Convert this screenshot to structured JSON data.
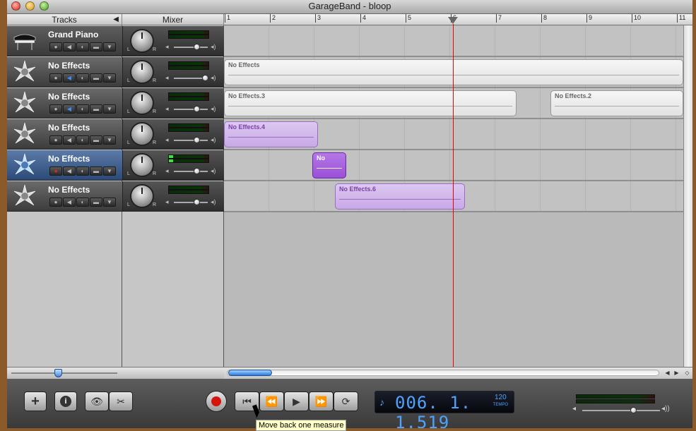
{
  "window": {
    "title": "GarageBand - bloop"
  },
  "headers": {
    "tracks": "Tracks",
    "mixer": "Mixer",
    "collapse_icon": "triangle-left-icon"
  },
  "ruler": {
    "marks": [
      "1",
      "2",
      "3",
      "4",
      "5",
      "6",
      "7",
      "8",
      "9",
      "10",
      "11"
    ]
  },
  "tracks": [
    {
      "name": "Grand Piano",
      "icon": "piano-icon",
      "selected": false
    },
    {
      "name": "No Effects",
      "icon": "star-guitar-icon",
      "selected": false
    },
    {
      "name": "No Effects",
      "icon": "star-guitar-icon",
      "selected": false
    },
    {
      "name": "No Effects",
      "icon": "star-guitar-icon",
      "selected": false
    },
    {
      "name": "No Effects",
      "icon": "star-guitar-icon",
      "selected": true
    },
    {
      "name": "No Effects",
      "icon": "star-guitar-icon",
      "selected": false
    }
  ],
  "mixer": {
    "pan_left": "L",
    "pan_right": "R"
  },
  "regions": {
    "r1": "No Effects",
    "r2a": "No Effects.3",
    "r2b": "No Effects.2",
    "r3": "No Effects.4",
    "r4": "No",
    "r5": "No Effects.6"
  },
  "lcd": {
    "position": "006. 1. 1.519",
    "tempo": "120",
    "tempo_label": "TEMPO"
  },
  "tooltip": {
    "text": "Move back one measure"
  },
  "toolbar": {
    "add": "+",
    "info": "i",
    "loop_browser": "eye-icon",
    "editor": "scissors-icon",
    "record": "record-icon",
    "to_start": "skip-to-start-icon",
    "rewind": "rewind-icon",
    "play": "play-icon",
    "forward": "fast-forward-icon",
    "cycle": "cycle-icon"
  }
}
